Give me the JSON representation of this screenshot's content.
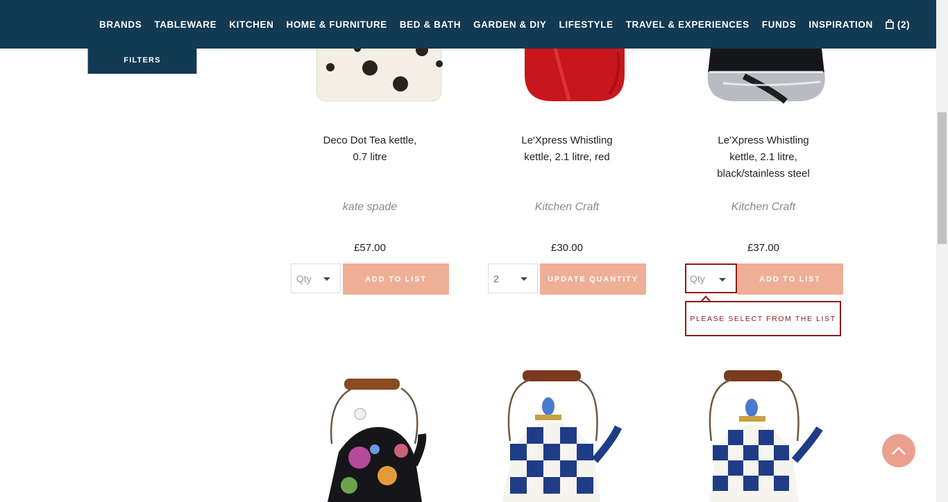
{
  "nav": {
    "items": [
      "BRANDS",
      "TABLEWARE",
      "KITCHEN",
      "HOME & FURNITURE",
      "BED & BATH",
      "GARDEN & DIY",
      "LIFESTYLE",
      "TRAVEL & EXPERIENCES",
      "FUNDS",
      "INSPIRATION"
    ],
    "cart_count": "(2)"
  },
  "filters_label": "FILTERS",
  "products": [
    {
      "name_line1": "Deco Dot Tea kettle,",
      "name_line2": "0.7 litre",
      "name_line3": "",
      "brand": "kate spade",
      "price": "£57.00",
      "qty": "Qty",
      "button": "ADD TO LIST"
    },
    {
      "name_line1": "Le'Xpress Whistling",
      "name_line2": "kettle, 2.1 litre, red",
      "name_line3": "",
      "brand": "Kitchen Craft",
      "price": "£30.00",
      "qty": "2",
      "button": "UPDATE QUANTITY"
    },
    {
      "name_line1": "Le'Xpress Whistling",
      "name_line2": "kettle, 2.1 litre,",
      "name_line3": "black/stainless steel",
      "brand": "Kitchen Craft",
      "price": "£37.00",
      "qty": "Qty",
      "button": "ADD TO LIST"
    }
  ],
  "validation_message": "PLEASE SELECT FROM THE LIST",
  "colors": {
    "nav_bg": "#123a52",
    "button_bg": "#eeaf96",
    "error": "#8f1a1a",
    "brand_text": "#8a8a8a"
  },
  "icons": [
    "shopping-bag-icon",
    "dropdown-caret-icon",
    "chevron-up-icon"
  ]
}
